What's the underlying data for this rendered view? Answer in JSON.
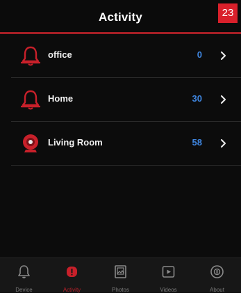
{
  "header": {
    "title": "Activity",
    "badge": "23"
  },
  "activity_list": [
    {
      "label": "office",
      "count": "0",
      "icon": "bell-icon"
    },
    {
      "label": "Home",
      "count": "30",
      "icon": "bell-icon"
    },
    {
      "label": "Living Room",
      "count": "58",
      "icon": "camera-icon"
    }
  ],
  "tabbar": {
    "tabs": [
      {
        "label": "Device",
        "icon": "bell-icon",
        "active": false
      },
      {
        "label": "Activity",
        "icon": "activity-icon",
        "active": true
      },
      {
        "label": "Photos",
        "icon": "photo-icon",
        "active": false
      },
      {
        "label": "Videos",
        "icon": "video-icon",
        "active": false
      },
      {
        "label": "About",
        "icon": "about-icon",
        "active": false
      }
    ]
  },
  "colors": {
    "accent": "#d9202b",
    "count": "#3f86e0",
    "background": "#0c0c0c"
  }
}
